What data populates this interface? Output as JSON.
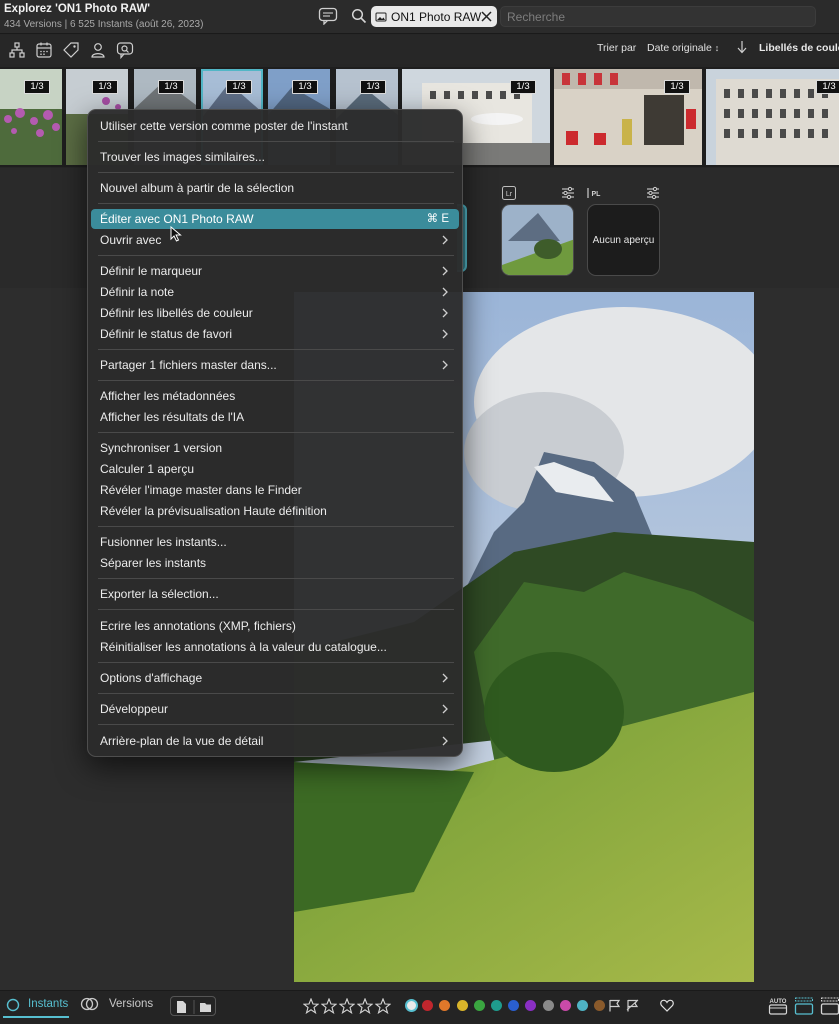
{
  "window": {
    "title": "Explorez 'ON1 Photo RAW'",
    "subtitle": "434 Versions | 6 525 Instants (août 26, 2023)"
  },
  "search": {
    "token_label": "ON1 Photo RAW",
    "placeholder": "Recherche"
  },
  "toolbar": {
    "icons": [
      "hierarchy-icon",
      "calendar-icon",
      "tag-icon",
      "person-icon",
      "chat-photo-icon"
    ],
    "sort_label": "Trier par",
    "sort_value": "Date originale",
    "sort_direction": "descending",
    "color_labels": "Libellés de couleur"
  },
  "filmstrip": {
    "badges": [
      "1/3",
      "1/3",
      "1/3",
      "1/3",
      "1/3",
      "1/3",
      "1/3",
      "1/3",
      "1/3"
    ]
  },
  "versions": {
    "labels": [
      "Lr",
      "PL"
    ],
    "no_preview": "Aucun aperçu"
  },
  "context_menu": {
    "items": [
      {
        "label": "Utiliser cette version comme poster de l'instant"
      },
      {
        "label": "Trouver les images similaires..."
      },
      {
        "label": "Nouvel album à partir de la sélection"
      },
      {
        "label": "Éditer avec ON1 Photo RAW",
        "shortcut": "⌘ E",
        "highlighted": true
      },
      {
        "label": "Ouvrir avec",
        "submenu": true
      },
      {
        "label": "Définir le marqueur",
        "submenu": true
      },
      {
        "label": "Définir la note",
        "submenu": true
      },
      {
        "label": "Définir les libellés de couleur",
        "submenu": true
      },
      {
        "label": "Définir le status de favori",
        "submenu": true
      },
      {
        "label": "Partager 1 fichiers master dans...",
        "submenu": true
      },
      {
        "label": "Afficher les métadonnées"
      },
      {
        "label": "Afficher les résultats de l'IA"
      },
      {
        "label": "Synchroniser 1 version"
      },
      {
        "label": "Calculer 1 aperçu"
      },
      {
        "label": "Révéler l'image master dans le Finder"
      },
      {
        "label": "Révéler la prévisualisation Haute définition"
      },
      {
        "label": "Fusionner les instants..."
      },
      {
        "label": "Séparer les instants"
      },
      {
        "label": "Exporter la sélection..."
      },
      {
        "label": "Ecrire les annotations (XMP, fichiers)"
      },
      {
        "label": "Réinitialiser les annotations à la valeur du catalogue..."
      },
      {
        "label": "Options d'affichage",
        "submenu": true
      },
      {
        "label": "Développeur",
        "submenu": true
      },
      {
        "label": "Arrière-plan de la vue de détail",
        "submenu": true
      }
    ]
  },
  "bottom_bar": {
    "instants_label": "Instants",
    "versions_label": "Versions",
    "rating_stars": 5,
    "color_dots": [
      "#e9e9e9",
      "#c0262d",
      "#e0782a",
      "#d9b42a",
      "#3aa640",
      "#1f9c8e",
      "#2a5fd0",
      "#8a2fc4",
      "#8a8a8a",
      "#c94aa8",
      "#4fb3c4",
      "#8a5a2b"
    ],
    "accent": "#57bfd0"
  }
}
